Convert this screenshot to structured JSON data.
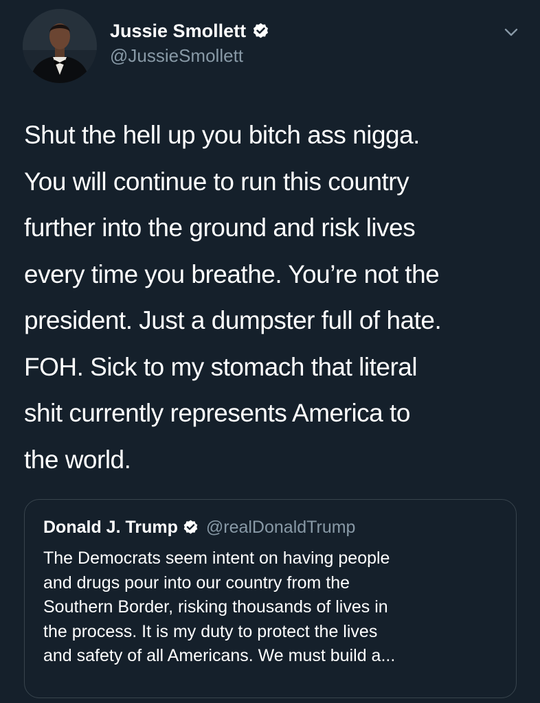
{
  "tweet": {
    "author": {
      "display_name": "Jussie Smollett",
      "handle": "@JussieSmollett",
      "verified_icon": "verified-badge-icon",
      "avatar_icon": "avatar-photo"
    },
    "menu_icon": "chevron-down-icon",
    "text": "Shut the hell up you bitch ass nigga.\nYou will continue to run this country\nfurther into the ground and risk lives\nevery time you breathe. You’re not the\npresident. Just a dumpster full of hate.\nFOH. Sick to my stomach that literal\nshit currently represents America to\nthe world.",
    "quoted_tweet": {
      "display_name": "Donald J. Trump",
      "handle": "@realDonaldTrump",
      "verified_icon": "verified-badge-icon",
      "text": "The Democrats seem intent on having people\nand drugs pour into our country from the\nSouthern Border, risking thousands of lives in\nthe process. It is my duty to protect the lives\nand safety of all Americans. We must build a..."
    }
  },
  "colors": {
    "background": "#15202b",
    "primary_text": "#ffffff",
    "secondary_text": "#8899a6",
    "quote_border": "#38444d"
  }
}
